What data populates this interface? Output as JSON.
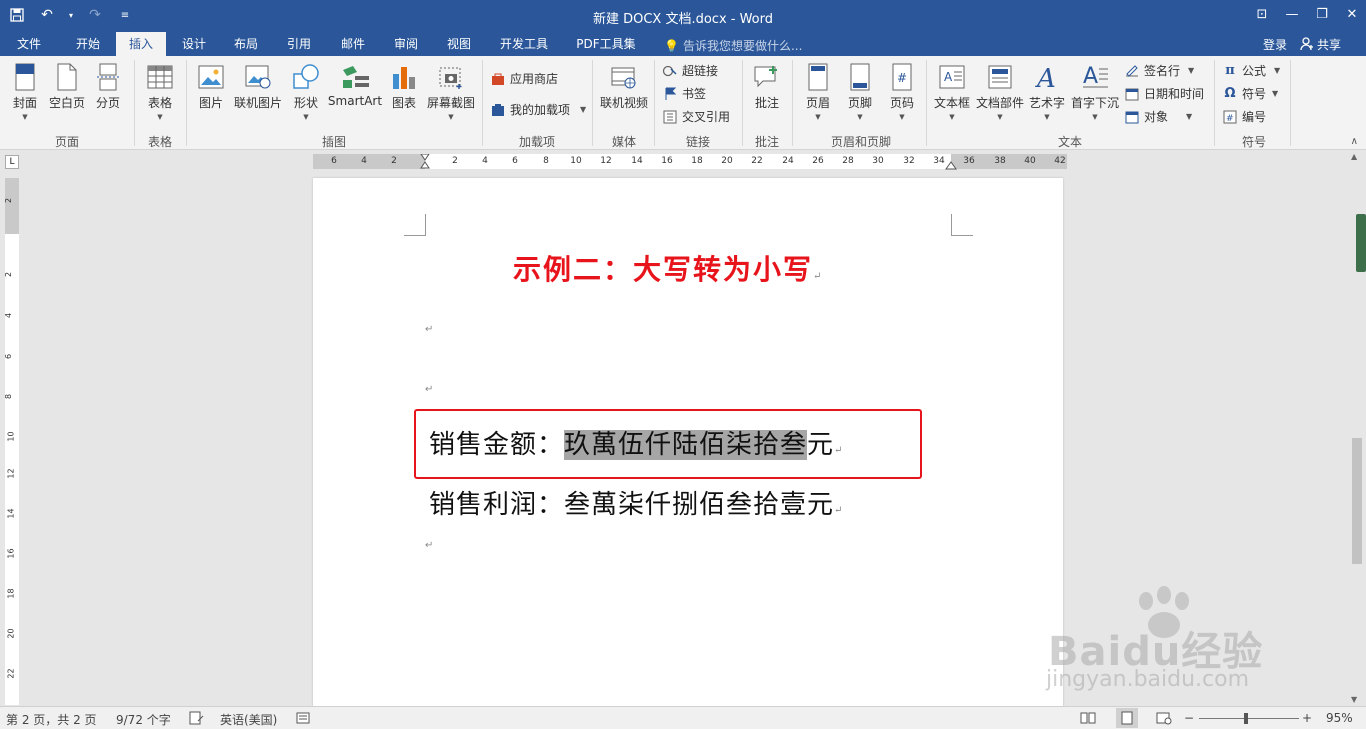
{
  "window": {
    "title": "新建 DOCX 文档.docx - Word",
    "qat_save": "💾",
    "qat_undo": "↶",
    "qat_redo": "↷",
    "qat_more": "≡",
    "ctl_help": "⊡",
    "ctl_min": "—",
    "ctl_restore": "❐",
    "ctl_close": "✕"
  },
  "tabs": [
    "文件",
    "开始",
    "插入",
    "设计",
    "布局",
    "引用",
    "邮件",
    "审阅",
    "视图",
    "开发工具",
    "PDF工具集"
  ],
  "active_tab": "插入",
  "tell_me": "告诉我您想要做什么...",
  "login": "登录",
  "share": "共享",
  "ribbon": {
    "cover": "封面",
    "blank_page": "空白页",
    "page_break": "分页",
    "table": "表格",
    "picture": "图片",
    "online_picture": "联机图片",
    "shapes": "形状",
    "smartart": "SmartArt",
    "chart": "图表",
    "screenshot": "屏幕截图",
    "app_store": "应用商店",
    "my_addins": "我的加载项",
    "online_video": "联机视频",
    "hyperlink": "超链接",
    "bookmark": "书签",
    "cross_ref": "交叉引用",
    "comment": "批注",
    "header": "页眉",
    "footer": "页脚",
    "page_number": "页码",
    "textbox": "文本框",
    "quick_parts": "文档部件",
    "wordart": "艺术字",
    "dropcap": "首字下沉",
    "signature": "签名行",
    "datetime": "日期和时间",
    "object": "对象",
    "equation": "公式",
    "symbol": "符号",
    "numbering": "编号"
  },
  "groups": {
    "pages": "页面",
    "tables": "表格",
    "illustrations": "插图",
    "addins": "加载项",
    "media": "媒体",
    "links": "链接",
    "comments": "批注",
    "header_footer": "页眉和页脚",
    "text": "文本",
    "symbols": "符号"
  },
  "ruler": {
    "h_ticks": [
      "6",
      "4",
      "2",
      "2",
      "4",
      "6",
      "8",
      "10",
      "12",
      "14",
      "16",
      "18",
      "20",
      "22",
      "24",
      "26",
      "28",
      "30",
      "32",
      "34",
      "36",
      "38",
      "40",
      "42"
    ],
    "v_ticks": [
      "2",
      "2",
      "4",
      "6",
      "8",
      "10",
      "12",
      "14",
      "16",
      "18",
      "20",
      "22"
    ],
    "corner": "L"
  },
  "document": {
    "heading": "示例二：大写转为小写",
    "line1_label": "销售金额：",
    "line1_selected": "玖萬伍仟陆佰柒拾叁",
    "line1_tail": "元",
    "line2_label": "销售利润：",
    "line2_value": "叁萬柒仟捌佰叁拾壹元",
    "para_mark": "↵"
  },
  "status": {
    "page": "第 2 页，共 2 页",
    "words": "9/72 个字",
    "lang": "英语(美国)",
    "zoom": "95%",
    "minus": "−",
    "plus": "+"
  },
  "watermark": {
    "brand": "Baidu经验",
    "url": "jingyan.baidu.com"
  },
  "colors": {
    "accent": "#2b579a",
    "heading_red": "#e8141b",
    "selection": "#a6a6a6"
  }
}
